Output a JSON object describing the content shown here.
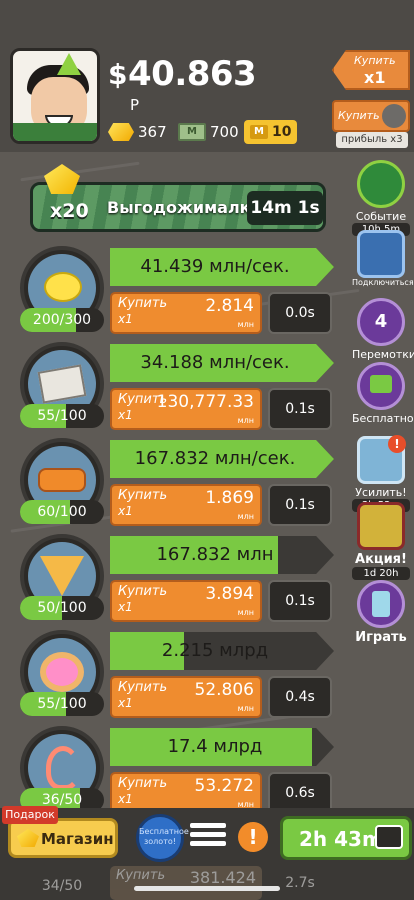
{
  "header": {
    "currency_sign": "$",
    "money": "40.863",
    "money_unit": "Р",
    "gold": "367",
    "megabucks": "700",
    "tickets": "10",
    "buy_tag_label": "Купить",
    "buy_tag_mult": "х1",
    "profit_button_label": "Купить",
    "profit_label": "прибыль х3"
  },
  "banner": {
    "multiplier": "x20",
    "title": "Выгодожималка",
    "timer": "14m 1s"
  },
  "businesses": [
    {
      "name": "lemon",
      "count": "200/300",
      "count_fill": 0.67,
      "profit": "41.439 млн/сек.",
      "progress": 1.0,
      "buy_label": "Купить",
      "buy_mult": "х1",
      "cost": "2.814",
      "cost_unit": "млн",
      "time": "0.0s"
    },
    {
      "name": "newspaper",
      "count": "55/100",
      "count_fill": 0.55,
      "profit": "34.188 млн/сек.",
      "progress": 1.0,
      "buy_label": "Купить",
      "buy_mult": "х1",
      "cost": "130,777.33",
      "cost_unit": "млн",
      "time": "0.1s"
    },
    {
      "name": "carwash",
      "count": "60/100",
      "count_fill": 0.6,
      "profit": "167.832 млн/сек.",
      "progress": 1.0,
      "buy_label": "Купить",
      "buy_mult": "х1",
      "cost": "1.869",
      "cost_unit": "млн",
      "time": "0.1s"
    },
    {
      "name": "pizza",
      "count": "50/100",
      "count_fill": 0.5,
      "profit": "167.832 млн",
      "progress": 0.75,
      "buy_label": "Купить",
      "buy_mult": "х1",
      "cost": "3.894",
      "cost_unit": "млн",
      "time": "0.1s"
    },
    {
      "name": "donut",
      "count": "55/100",
      "count_fill": 0.55,
      "profit": "2.215 млрд",
      "progress": 0.33,
      "buy_label": "Купить",
      "buy_mult": "х1",
      "cost": "52.806",
      "cost_unit": "млн",
      "time": "0.4s"
    },
    {
      "name": "shrimp",
      "count": "36/50",
      "count_fill": 0.72,
      "profit": "17.4 млрд",
      "progress": 0.9,
      "buy_label": "Купить",
      "buy_mult": "х1",
      "cost": "53.272",
      "cost_unit": "млн",
      "time": "0.6s"
    }
  ],
  "partial_row": {
    "count": "34/50",
    "buy_label": "Купить",
    "cost": "381.424",
    "time": "2.7s"
  },
  "sidebar": [
    {
      "label": "Событие",
      "sub": "10h 5m"
    },
    {
      "label": "Подключиться",
      "sub": ""
    },
    {
      "label": "Перемотки",
      "sub": "",
      "badge": "4"
    },
    {
      "label": "Бесплатно!",
      "sub": ""
    },
    {
      "label": "Усилить!",
      "sub": "3h 53m",
      "alert": "!"
    },
    {
      "label": "Акция!",
      "sub": "1d 20h"
    },
    {
      "label": "Играть",
      "sub": ""
    }
  ],
  "bottom": {
    "gift_label": "Подарок",
    "shop_label": "Магазин",
    "free_gold_label": "Бесплатное золото!",
    "alert": "!",
    "timer": "2h 43m"
  }
}
